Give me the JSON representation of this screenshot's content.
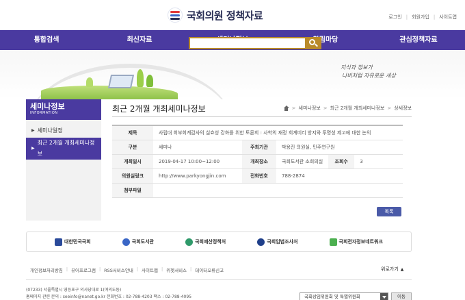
{
  "header": {
    "logo_text": "국회의원 정책자료",
    "util_links": [
      "로그인",
      "회원가입",
      "사이트맵"
    ]
  },
  "gnb": [
    "통합검색",
    "최신자료",
    "세미나정보",
    "알림마당",
    "관심정책자료"
  ],
  "visual": {
    "slogan_line1": "지식과 정보가",
    "slogan_line2": "나비처럼 자유로운 세상"
  },
  "search": {
    "placeholder": ""
  },
  "sidebar": {
    "title": "세미나정보",
    "subtitle": "INFORMATION",
    "items": [
      {
        "label": "세미나일정",
        "active": false
      },
      {
        "label": "최근 2개월 개최세미나정보",
        "active": true
      }
    ]
  },
  "content": {
    "title": "최근 2개월 개최세미나정보",
    "breadcrumb": [
      "세미나정보",
      "최근 2개월 개최세미나정보",
      "상세정보"
    ]
  },
  "detail": {
    "title_label": "제목",
    "title_value": "사립대 회부회계감사의 실효성 강화를 위한 토론회 : 사학의 재정 회계비리 방지와 투명성 제고에 대한 논의",
    "type_label": "구분",
    "type_value": "세미나",
    "host_label": "주최기관",
    "host_value": "박용진 의원실, 민주연구원",
    "date_label": "개최일시",
    "date_value": "2019-04-17 10:00~12:00",
    "place_label": "개최장소",
    "place_value": "국회도서관 소회의실",
    "views_label": "조회수",
    "views_value": "3",
    "link_label": "의원실링크",
    "link_value": "http://www.parkyongjin.com",
    "phone_label": "전화번호",
    "phone_value": "788-2874",
    "attach_label": "첨부파일",
    "attach_value": ""
  },
  "buttons": {
    "list": "목록",
    "go": "이동"
  },
  "related": [
    "대한민국국회",
    "국회도서관",
    "국회예산정책처",
    "국회입법조사처",
    "국회전자정보네트워크"
  ],
  "footer": {
    "links": [
      "개인정보처리방침",
      "뷰어프로그램",
      "RSS서비스안내",
      "사이트맵",
      "위젯서비스",
      "데이터오류신고"
    ],
    "top_label": "위로가기",
    "address_line1": "(07233) 서울특별시 영등포구 의사당대로 1(여의도동)",
    "address_line2": "홈페이지 관련 문의 : seeinfo@nanet.go.kr    전화번호 : 02-788-4203    팩스 : 02-788-4095",
    "site_select": "국회상임위원회 및 특별위원회"
  },
  "colors": {
    "brand": "#4a3aa0",
    "search": "#b98a2a",
    "list_button": "#4a5aa8"
  }
}
